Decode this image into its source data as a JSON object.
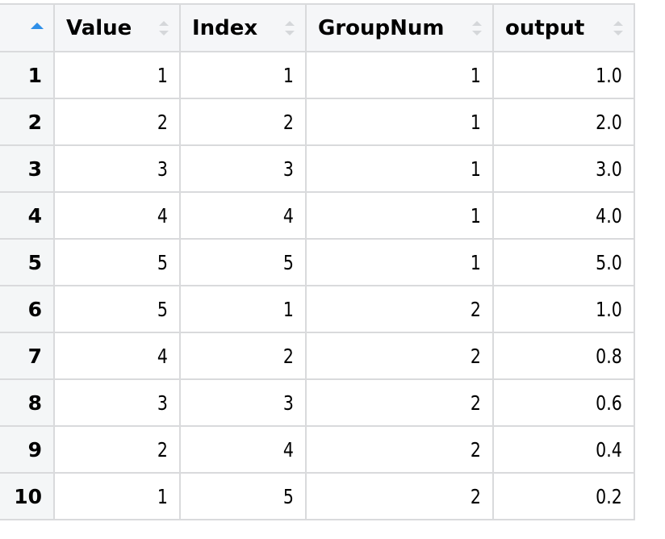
{
  "table": {
    "row_number_header": {
      "sort_state": "ascending",
      "sort_icon": "sort-ascending-icon",
      "accent_color": "#2f8fe8"
    },
    "columns": [
      {
        "key": "Value",
        "label": "Value",
        "sort_icon": "sort-both-icon"
      },
      {
        "key": "Index",
        "label": "Index",
        "sort_icon": "sort-both-icon"
      },
      {
        "key": "GroupNum",
        "label": "GroupNum",
        "sort_icon": "sort-both-icon"
      },
      {
        "key": "output",
        "label": "output",
        "sort_icon": "sort-both-icon"
      }
    ],
    "rows": [
      {
        "row_number": "1",
        "cells": [
          "1",
          "1",
          "1",
          "1.0"
        ]
      },
      {
        "row_number": "2",
        "cells": [
          "2",
          "2",
          "1",
          "2.0"
        ]
      },
      {
        "row_number": "3",
        "cells": [
          "3",
          "3",
          "1",
          "3.0"
        ]
      },
      {
        "row_number": "4",
        "cells": [
          "4",
          "4",
          "1",
          "4.0"
        ]
      },
      {
        "row_number": "5",
        "cells": [
          "5",
          "5",
          "1",
          "5.0"
        ]
      },
      {
        "row_number": "6",
        "cells": [
          "5",
          "1",
          "2",
          "1.0"
        ]
      },
      {
        "row_number": "7",
        "cells": [
          "4",
          "2",
          "2",
          "0.8"
        ]
      },
      {
        "row_number": "8",
        "cells": [
          "3",
          "3",
          "2",
          "0.6"
        ]
      },
      {
        "row_number": "9",
        "cells": [
          "2",
          "4",
          "2",
          "0.4"
        ]
      },
      {
        "row_number": "10",
        "cells": [
          "1",
          "5",
          "2",
          "0.2"
        ]
      }
    ]
  }
}
